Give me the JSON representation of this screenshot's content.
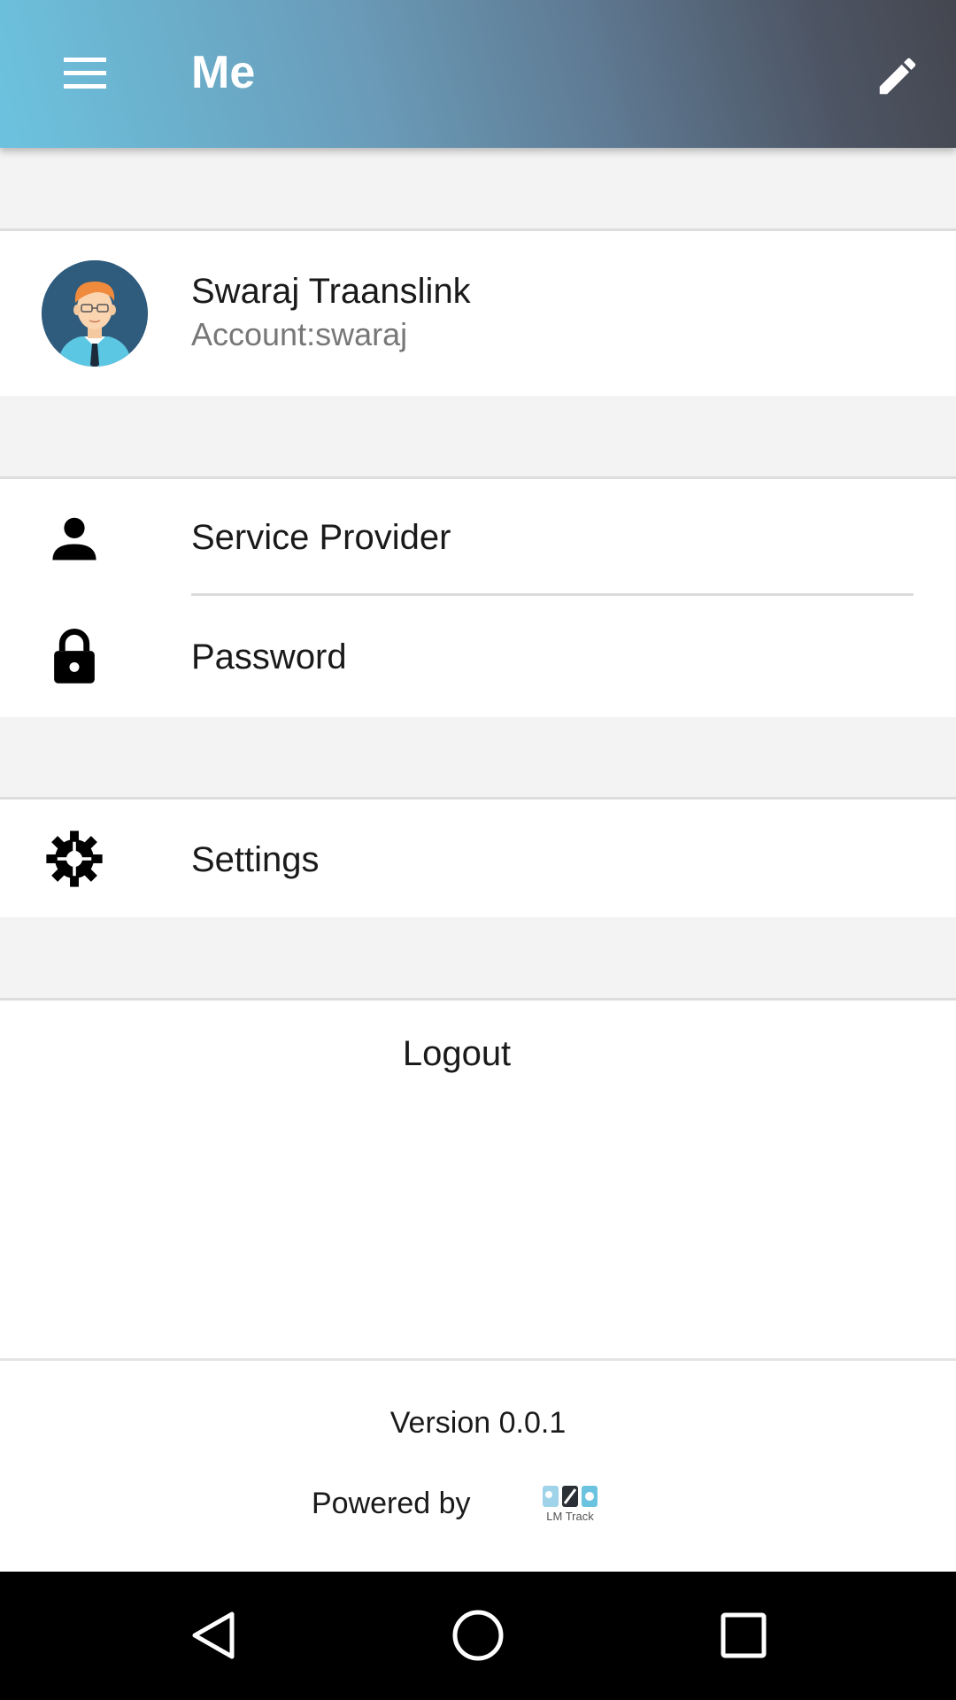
{
  "appbar": {
    "title": "Me",
    "menu_icon": "menu-icon",
    "edit_icon": "edit-icon"
  },
  "profile": {
    "name": "Swaraj Traanslink",
    "account": "Account:swaraj",
    "avatar_icon": "avatar-icon"
  },
  "menu": {
    "service_provider": "Service Provider",
    "password": "Password",
    "settings": "Settings"
  },
  "logout_label": "Logout",
  "footer": {
    "version": "Version 0.0.1",
    "powered_by": "Powered by",
    "brand": "LM Track"
  },
  "nav": {
    "back_icon": "back-icon",
    "home_icon": "home-icon",
    "recents_icon": "recents-icon"
  },
  "colors": {
    "appbar_start": "#6cc3df",
    "appbar_end": "#44464f",
    "section_gap": "#f3f3f3",
    "secondary_text": "#777777"
  }
}
